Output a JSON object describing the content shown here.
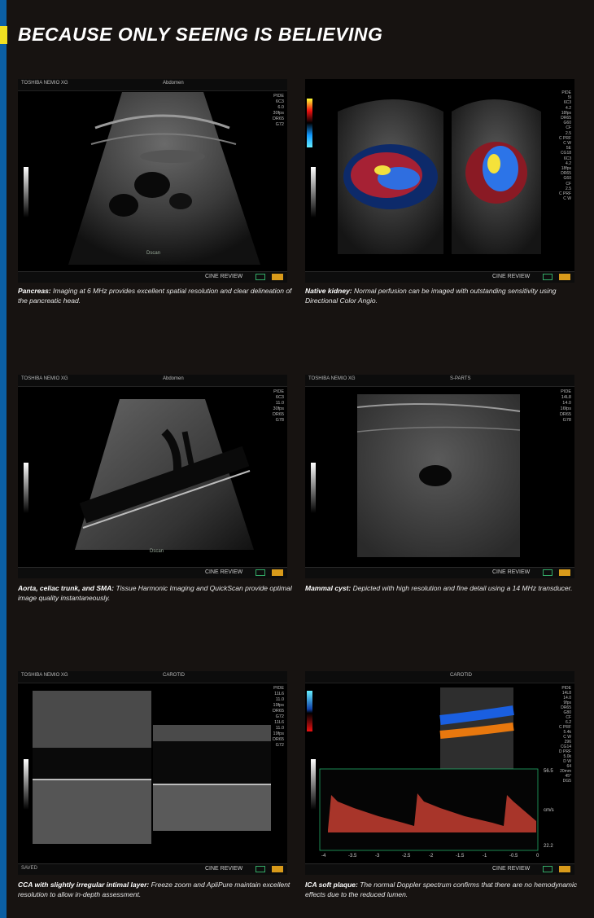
{
  "heading": "BECAUSE ONLY SEEING IS BELIEVING",
  "panels": [
    {
      "brand": "TOSHIBA NEMIO XG",
      "mode": "Abdomen",
      "params": "PIDE\n6C3\n6.0\n30fps\nDR65\nG72",
      "mark": "Dscan",
      "footer": "CINE REVIEW",
      "lead": "Pancreas:",
      "text": " Imaging at 6 MHz provides excellent spatial resolution and clear delineation of the pancreatic head."
    },
    {
      "brand": "",
      "mode": "",
      "params": "PIDE\n5I\n6C3\n4.2\n18fps\nDR65\nG60\nCF\n2.5\nC PRF\nC W\n5E\nCG18\n6C3\n4.2\n18fps\nDR65\nG60\nCF\n2.5\nC PRF\nC W",
      "mark": "",
      "footer": "CINE REVIEW",
      "lead": "Native kidney:",
      "text": " Normal perfusion can be imaged with outstanding sensitivity using Directional Color Angio."
    },
    {
      "brand": "TOSHIBA NEMIO XG",
      "mode": "Abdomen",
      "params": "PIDE\n6C3\n11.0\n30fps\nDR65\nG78",
      "mark": "Dscan",
      "footer": "CINE REVIEW",
      "lead": "Aorta, celiac trunk, and SMA:",
      "text": " Tissue Harmonic Imaging and QuickScan provide optimal image quality instantaneously."
    },
    {
      "brand": "TOSHIBA NEMIO XG",
      "mode": "S-PARTS",
      "params": "PIDE\n14L8\n14.0\n16fps\nDR65\nG78",
      "mark": "",
      "footer": "CINE REVIEW",
      "lead": "Mammal cyst:",
      "text": " Depicted with high resolution and fine detail using a 14 MHz transducer."
    },
    {
      "brand": "TOSHIBA NEMIO XG",
      "mode": "CAROTID",
      "params": "PIDE\n11L6\n11.0\n19fps\nDR65\nG72\n11L6\n11.0\n19fps\nDR65\nG72",
      "mark": "SAVED",
      "footer": "CINE REVIEW",
      "lead": "CCA with slightly irregular intimal layer:",
      "text": " Freeze zoom and ApliPure maintain excellent resolution to allow in-depth assessment."
    },
    {
      "brand": "",
      "mode": "CAROTID",
      "params": "PIDE\n14L8\n14.0\n9fps\nDR65\nG80\nCF\n6.2\nC PRF\n5.4k\nC W\n296\nCG14\nD PRF\n5.0k\nD W\n64\n20mm\n45°\nDG5",
      "mark": "",
      "footer": "CINE REVIEW",
      "lead": "ICA soft plaque:",
      "text": " The normal Doppler spectrum confirms that there are no hemodynamic effects due to the reduced lumen."
    }
  ],
  "doppler_ticks": [
    "-4",
    "-3.5",
    "-3",
    "-2.5",
    "-2",
    "-1.5",
    "-1",
    "-0.5",
    "0"
  ],
  "doppler_scale": [
    "56.5",
    "cm/s",
    "22.2"
  ]
}
